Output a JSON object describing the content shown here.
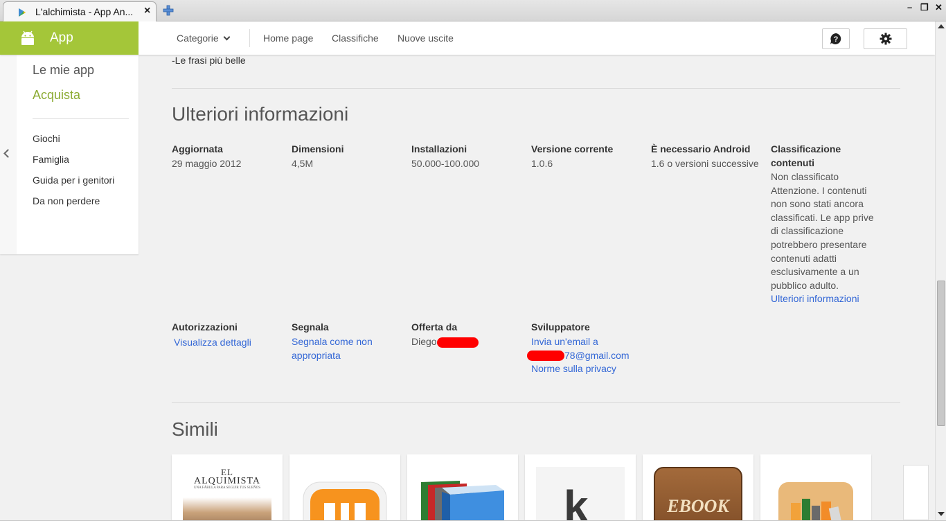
{
  "browser": {
    "tab_title": "L'alchimista - App An...",
    "tab_close": "×",
    "minimize": "–",
    "restore": "❒",
    "close": "✕"
  },
  "nav": {
    "brand": "App",
    "categories": "Categorie",
    "home": "Home page",
    "charts": "Classifiche",
    "new_releases": "Nuove uscite",
    "help_icon": "help-icon",
    "settings_icon": "gear-icon"
  },
  "sidebar": {
    "main": [
      {
        "label": "Le mie app"
      },
      {
        "label": "Acquista"
      }
    ],
    "sub": [
      {
        "label": "Giochi"
      },
      {
        "label": "Famiglia"
      },
      {
        "label": "Guida per i genitori"
      },
      {
        "label": "Da non perdere"
      }
    ]
  },
  "content": {
    "prev_line": "-Le frasi più belle",
    "info_title": "Ulteriori informazioni",
    "meta": {
      "updated_label": "Aggiornata",
      "updated_value": "29 maggio 2012",
      "size_label": "Dimensioni",
      "size_value": "4,5M",
      "installs_label": "Installazioni",
      "installs_value": "50.000-100.000",
      "version_label": "Versione corrente",
      "version_value": "1.0.6",
      "android_label": "È necessario Android",
      "android_value": "1.6 o versioni successive",
      "rating_label_1": "Classificazione",
      "rating_label_2": "contenuti",
      "rating_value_lines": [
        "Non classificato",
        "Attenzione. I contenuti",
        "non sono stati ancora",
        "classificati. Le app prive",
        "di classificazione",
        "potrebbero presentare",
        "contenuti adatti",
        "esclusivamente a un",
        "pubblico adulto."
      ],
      "rating_link": "Ulteriori informazioni",
      "permissions_label": "Autorizzazioni",
      "permissions_link": "Visualizza dettagli",
      "report_label": "Segnala",
      "report_link_1": "Segnala come non",
      "report_link_2": "appropriata",
      "offered_label": "Offerta da",
      "offered_value": "Diego",
      "developer_label": "Sviluppatore",
      "developer_email_1": "Invia un'email a",
      "developer_email_2": "78@gmail.com",
      "developer_privacy": "Norme sulla privacy"
    },
    "similar_title": "Simili",
    "similar_cards": [
      {
        "icon": "book-cover-el-alquimista",
        "cover_line_1": "EL",
        "cover_line_2": "ALQUIMISTA",
        "cover_line_3": "UNA FÁBULA PARA SEGUIR TUS SUEÑOS"
      },
      {
        "icon": "orange-m-logo-icon"
      },
      {
        "icon": "stacked-books-icon"
      },
      {
        "icon": "kobo-k-logo-icon",
        "letter": "k"
      },
      {
        "icon": "ebook-leather-icon",
        "label": "EBOOK"
      },
      {
        "icon": "bookshelf-icon"
      }
    ]
  },
  "colors": {
    "brand_green": "#a4c639",
    "active_green": "#8cab34",
    "link_blue": "#3367d6",
    "redaction": "#ff0000"
  }
}
